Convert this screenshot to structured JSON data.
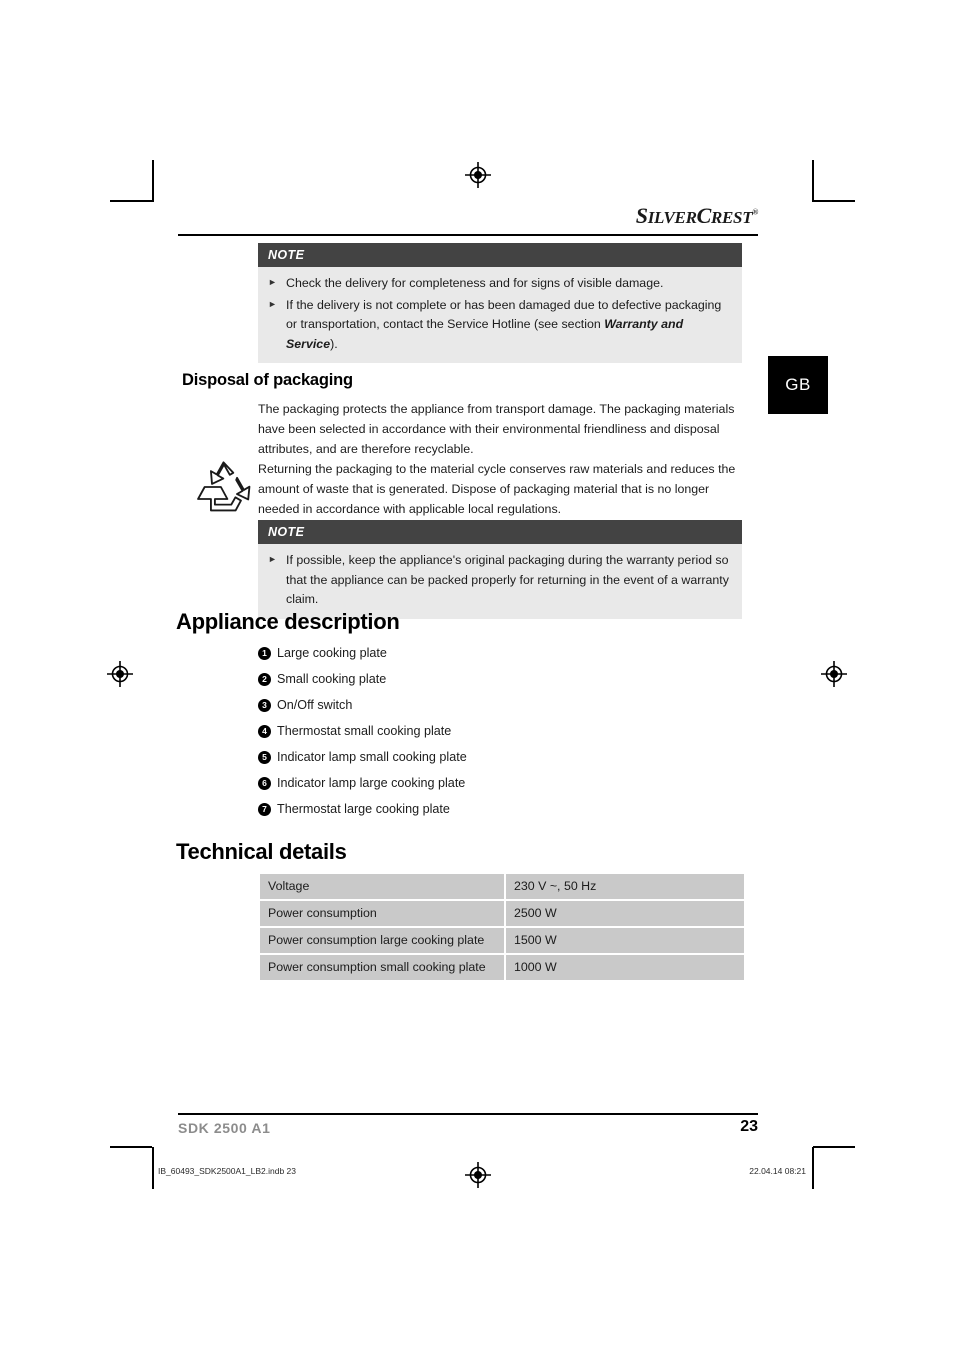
{
  "page": {
    "language_tab": "GB",
    "brand": {
      "part1": "S",
      "part2": "ILVER",
      "part3": "C",
      "part4": "REST",
      "trademark": "®"
    }
  },
  "note_top": {
    "header": "NOTE",
    "items": [
      {
        "text": "Check the delivery for completeness and for signs of visible damage."
      },
      {
        "text_before": "If the delivery is not complete or has been damaged due to defective packaging or transportation, contact the Service Hotline (see section ",
        "emphasis": "Warranty and Service",
        "text_after": ")."
      }
    ]
  },
  "disposal": {
    "heading": "Disposal of packaging",
    "paragraph1": "The packaging protects the appliance from transport damage. The packaging materials have been selected in accordance with their environmental friendliness and disposal attributes, and are therefore recyclable.",
    "paragraph2": "Returning the packaging to the material cycle conserves raw materials and reduces the amount of waste that is generated. Dispose of packaging material that is no longer needed in accordance with applicable local regulations.",
    "icon": "recycling-icon"
  },
  "note_bottom": {
    "header": "NOTE",
    "items": [
      {
        "text": "If possible, keep the appliance's original packaging during the warranty period so that the appliance can be packed properly for returning in the event of a warranty claim."
      }
    ]
  },
  "appliance_description": {
    "heading": "Appliance description",
    "parts": [
      {
        "number": "1",
        "label": "Large cooking plate"
      },
      {
        "number": "2",
        "label": "Small cooking plate"
      },
      {
        "number": "3",
        "label": "On/Off switch"
      },
      {
        "number": "4",
        "label": "Thermostat small cooking plate"
      },
      {
        "number": "5",
        "label": "Indicator lamp small cooking plate"
      },
      {
        "number": "6",
        "label": "Indicator lamp large cooking plate"
      },
      {
        "number": "7",
        "label": "Thermostat large cooking plate"
      }
    ]
  },
  "technical_details": {
    "heading": "Technical details",
    "rows": [
      {
        "key": "Voltage",
        "value": "230 V ~, 50 Hz"
      },
      {
        "key": "Power consumption",
        "value": "2500 W"
      },
      {
        "key": "Power consumption large cooking plate",
        "value": "1500 W"
      },
      {
        "key": "Power consumption small cooking plate",
        "value": "1000 W"
      }
    ]
  },
  "footer": {
    "model": "SDK 2500 A1",
    "page_number": "23",
    "print_file": "IB_60493_SDK2500A1_LB2.indb   23",
    "print_timestamp": "22.04.14   08:21"
  },
  "colors": {
    "note_header_bg": "#434343",
    "note_body_bg": "#e9e9e9",
    "table_cell_bg": "#c9c9c9",
    "tab_bg": "#000000",
    "footer_model": "#8c8c8c"
  }
}
